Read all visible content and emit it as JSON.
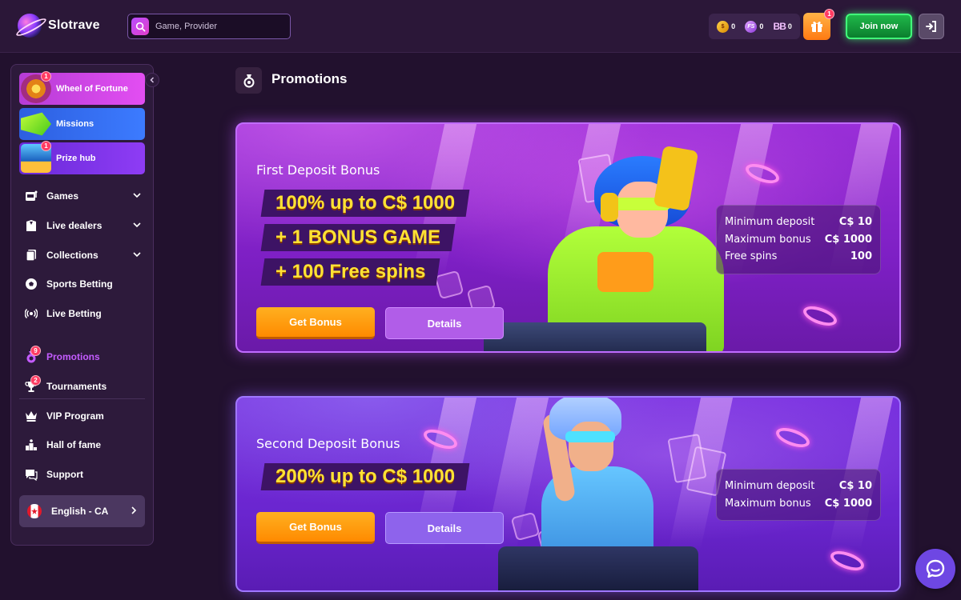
{
  "brand": {
    "name": "Slotrave"
  },
  "search": {
    "placeholder": "Game, Provider"
  },
  "balances": [
    {
      "icon": "gold-coin-icon",
      "value": "0"
    },
    {
      "icon": "free-spins-icon",
      "value": "0"
    },
    {
      "icon": "bonus-balance-icon",
      "value": "0"
    }
  ],
  "gift": {
    "badge": "1"
  },
  "header": {
    "join_label": "Join now"
  },
  "sidebar": {
    "featured": [
      {
        "label": "Wheel of Fortune",
        "badge": "1"
      },
      {
        "label": "Missions"
      },
      {
        "label": "Prize hub",
        "badge": "1"
      }
    ],
    "nav": [
      {
        "label": "Games"
      },
      {
        "label": "Live dealers"
      },
      {
        "label": "Collections"
      },
      {
        "label": "Sports Betting"
      },
      {
        "label": "Live Betting"
      }
    ],
    "nav2": [
      {
        "label": "Promotions",
        "badge": "9"
      },
      {
        "label": "Tournaments",
        "badge": "2"
      },
      {
        "label": "VIP Program"
      },
      {
        "label": "Hall of fame"
      },
      {
        "label": "Support"
      }
    ],
    "language": "English - CA"
  },
  "page": {
    "title": "Promotions"
  },
  "promos": [
    {
      "name": "First Deposit Bonus",
      "lines": [
        "100% up to C$ 1000",
        "+ 1 BONUS GAME",
        "+ 100 Free spins"
      ],
      "get_label": "Get Bonus",
      "details_label": "Details",
      "info": [
        {
          "label": "Minimum deposit",
          "value": "C$ 10"
        },
        {
          "label": "Maximum bonus",
          "value": "C$ 1000"
        },
        {
          "label": "Free spins",
          "value": "100"
        }
      ]
    },
    {
      "name": "Second Deposit Bonus",
      "lines": [
        "200% up to C$ 1000"
      ],
      "get_label": "Get Bonus",
      "details_label": "Details",
      "info": [
        {
          "label": "Minimum deposit",
          "value": "C$ 10"
        },
        {
          "label": "Maximum bonus",
          "value": "C$ 1000"
        }
      ]
    }
  ],
  "colors": {
    "accent": "#c45cff",
    "join": "#1fb84a",
    "get_bonus": "#ff8a00",
    "offer_text": "#ffe234"
  }
}
